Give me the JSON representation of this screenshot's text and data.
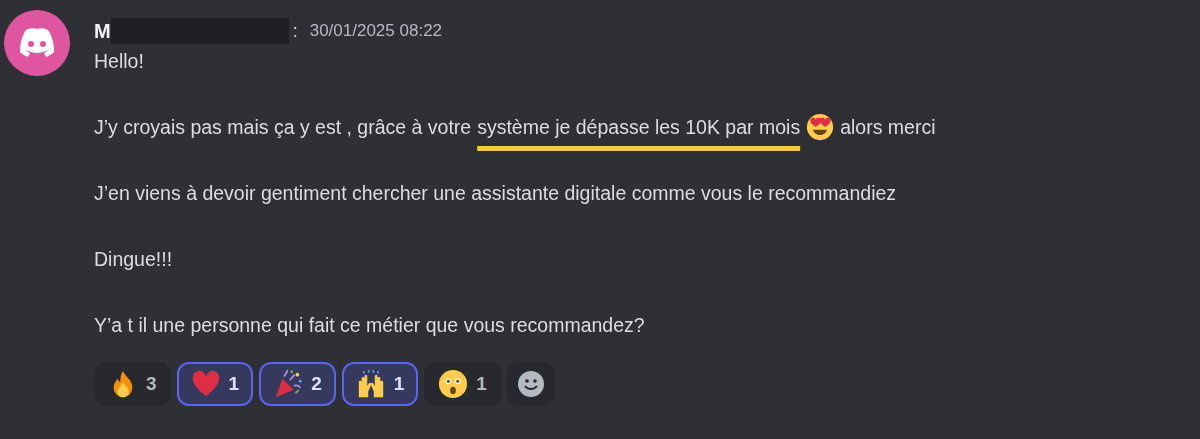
{
  "message": {
    "author": "M",
    "author_suffix": ":",
    "timestamp": "30/01/2025 08:22",
    "paragraphs": [
      {
        "kind": "plain",
        "text": "Hello!"
      },
      {
        "kind": "highlighted",
        "before": "J’y croyais pas mais ça y est , grâce à votre",
        "highlight": "système je dépasse les 10K par mois",
        "emoji": {
          "kind": "heart-eyes"
        },
        "after": "alors merci"
      },
      {
        "kind": "plain",
        "text": "J’en viens à devoir gentiment chercher une assistante digitale comme vous le recommandiez"
      },
      {
        "kind": "plain",
        "text": "Dingue!!!"
      },
      {
        "kind": "plain",
        "text": "Y’a t il une personne qui fait ce métier que vous recommandez?"
      }
    ],
    "reactions": [
      {
        "kind": "fire",
        "count": "3",
        "selected": false
      },
      {
        "kind": "heart",
        "count": "1",
        "selected": true
      },
      {
        "kind": "party",
        "count": "2",
        "selected": true
      },
      {
        "kind": "hands",
        "count": "1",
        "selected": true
      },
      {
        "kind": "astonished",
        "count": "1",
        "selected": false
      }
    ]
  }
}
